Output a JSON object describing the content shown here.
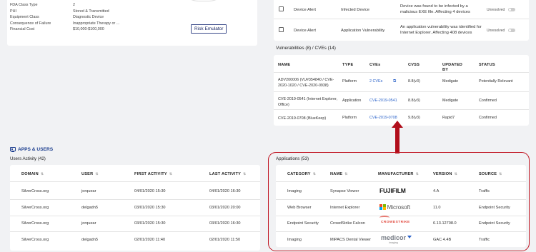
{
  "device": {
    "fields": [
      {
        "label": "FDA Class Type",
        "value": "2"
      },
      {
        "label": "PHI",
        "value": "Stored & Transmitted"
      },
      {
        "label": "Equipment Class",
        "value": "Diagnostic Device"
      },
      {
        "label": "Consequence of Failure",
        "value": "Inappropriate Therapy or ..."
      },
      {
        "label": "Financial Cost",
        "value": "$10,000-$100,000"
      }
    ],
    "risk_button": "Risk Emulator"
  },
  "alerts": {
    "rows": [
      {
        "type": "Device Alert",
        "category": "Infected Device",
        "description": "Device was found to be infected by a malicious EXE file. Affecting 4 devices",
        "status": "Unresolved"
      },
      {
        "type": "Device Alert",
        "category": "Application Vulnerability",
        "description": "An application vulnerability was identified for Internet Explorer. Affecting 408 devices",
        "status": "Unresolved"
      }
    ]
  },
  "vulnerabilities": {
    "title": "Vulnerabilities (8) / CVEs (14)",
    "headers": [
      "NAME",
      "TYPE",
      "CVEs",
      "CVSS",
      "UPDATED BY",
      "STATUS"
    ],
    "rows": [
      {
        "name": "ADV200006 (VU#354840 / CVE-2020-1020 / CVE-2020-0938)",
        "type": "Platform",
        "cves": "2 CVEs",
        "cvss": "8.8(v3)",
        "updated": "Medigate",
        "status": "Potentially Relevant"
      },
      {
        "name": "CVE-2019-0541 (Internet Explorer, Office)",
        "type": "Application",
        "cves": "CVE-2019-0541",
        "cvss": "8.8(v3)",
        "updated": "Medigate",
        "status": "Confirmed"
      },
      {
        "name": "CVE-2019-0708 (BlueKeep)",
        "type": "Platform",
        "cves": "CVE-2019-0708",
        "cvss": "9.8(v3)",
        "updated": "Rapid7",
        "status": "Confirmed"
      }
    ]
  },
  "apps_users": {
    "section_title": "APPS & USERS",
    "users_title": "Users Activity (42)",
    "users_headers": [
      "DOMAIN",
      "USER",
      "FIRST ACTIVITY",
      "LAST ACTIVITY"
    ],
    "users_rows": [
      {
        "domain": "SilverCross.org",
        "user": "jorquear",
        "first": "04/01/2020 15:30",
        "last": "04/01/2020 16:30"
      },
      {
        "domain": "SilverCross.org",
        "user": "delgadn5",
        "first": "03/01/2020 15:30",
        "last": "03/01/2020 20:00"
      },
      {
        "domain": "SilverCross.org",
        "user": "jorquear",
        "first": "03/01/2020 15:30",
        "last": "03/01/2020 16:30"
      },
      {
        "domain": "SilverCross.org",
        "user": "delgadn5",
        "first": "02/01/2020 11:40",
        "last": "02/01/2020 11:50"
      }
    ],
    "apps_title": "Applications (53)",
    "apps_headers": [
      "CATEGORY",
      "NAME",
      "MANUFACTURER",
      "VERSION",
      "SOURCE"
    ],
    "apps_rows": [
      {
        "category": "Imaging",
        "name": "Synapse Viewer",
        "manufacturer": "FUJIFILM",
        "version": "4.A",
        "source": "Traffic"
      },
      {
        "category": "Web Browser",
        "name": "Internet Explorer",
        "manufacturer": "Microsoft",
        "version": "11.0",
        "source": "Endpoint Security"
      },
      {
        "category": "Endpoint Security",
        "name": "CrowdStrike Falcon",
        "manufacturer": "CROWDSTRIKE",
        "version": "6.13.12708.0",
        "source": "Endpoint Security"
      },
      {
        "category": "Imaging",
        "name": "MiPACS Dental Viewer",
        "manufacturer": "medicor",
        "manufacturer_sub": "imaging",
        "version": "GAC 4.4B",
        "source": "Traffic"
      }
    ]
  },
  "colors": {
    "highlight": "#c0121f",
    "link": "#2a62c9",
    "microsoft": [
      "#f25022",
      "#7fba00",
      "#00a4ef",
      "#ffb900"
    ],
    "crowdstrike": "#e0453a"
  }
}
